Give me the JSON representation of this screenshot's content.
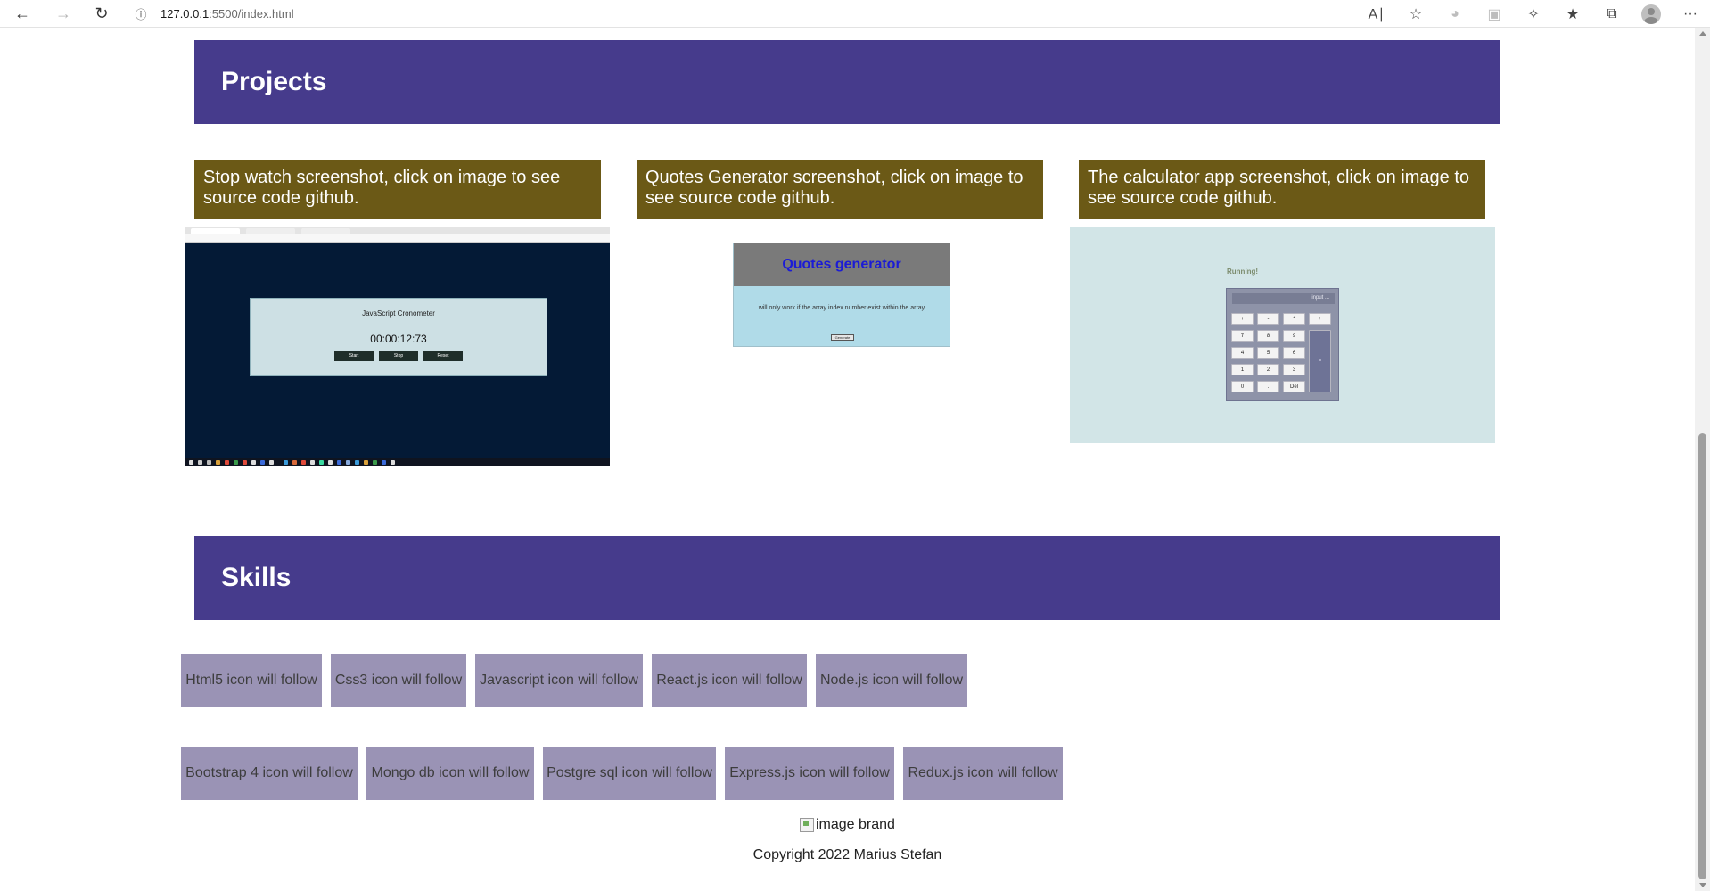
{
  "browser": {
    "url_host": "127.0.0.1",
    "url_rest": ":5500/index.html",
    "back_icon": "arrow-left",
    "forward_icon": "arrow-right",
    "refresh_icon": "refresh"
  },
  "projects": {
    "title": "Projects",
    "items": [
      {
        "caption": "Stop watch screenshot, click on image to see source code github."
      },
      {
        "caption": "Quotes Generator screenshot, click on image to see source code github."
      },
      {
        "caption": "The calculator app screenshot, click on image to see source code github."
      }
    ],
    "stopwatch": {
      "title": "JavaScript Cronometer",
      "time": "00:00:12:73",
      "buttons": [
        "Start",
        "Stop",
        "Reset"
      ]
    },
    "quotes": {
      "title": "Quotes generator",
      "text": "will only work if the array index number exist within the array",
      "button": "Generate"
    },
    "calculator": {
      "status": "Running! ",
      "display": "input ...",
      "keys": [
        "+",
        "-",
        "*",
        "÷",
        "7",
        "8",
        "9",
        "4",
        "5",
        "6",
        "1",
        "2",
        "3",
        "0",
        ".",
        "Del"
      ],
      "equals": "="
    }
  },
  "skills": {
    "title": "Skills",
    "row1": [
      "Html5 icon will follow",
      "Css3 icon will follow",
      "Javascript icon will follow",
      "React.js icon will follow",
      "Node.js icon will follow"
    ],
    "row2": [
      "Bootstrap 4 icon will follow",
      "Mongo db icon will follow",
      "Postgre sql icon will follow",
      "Express.js icon will follow",
      "Redux.js icon will follow"
    ]
  },
  "footer": {
    "brand_alt": "image brand",
    "copyright": "Copyright 2022 Marius Stefan"
  },
  "colors": {
    "header_bg": "#463b8c",
    "caption_bg": "#6b5916",
    "skill_bg": "#9a93b5"
  }
}
